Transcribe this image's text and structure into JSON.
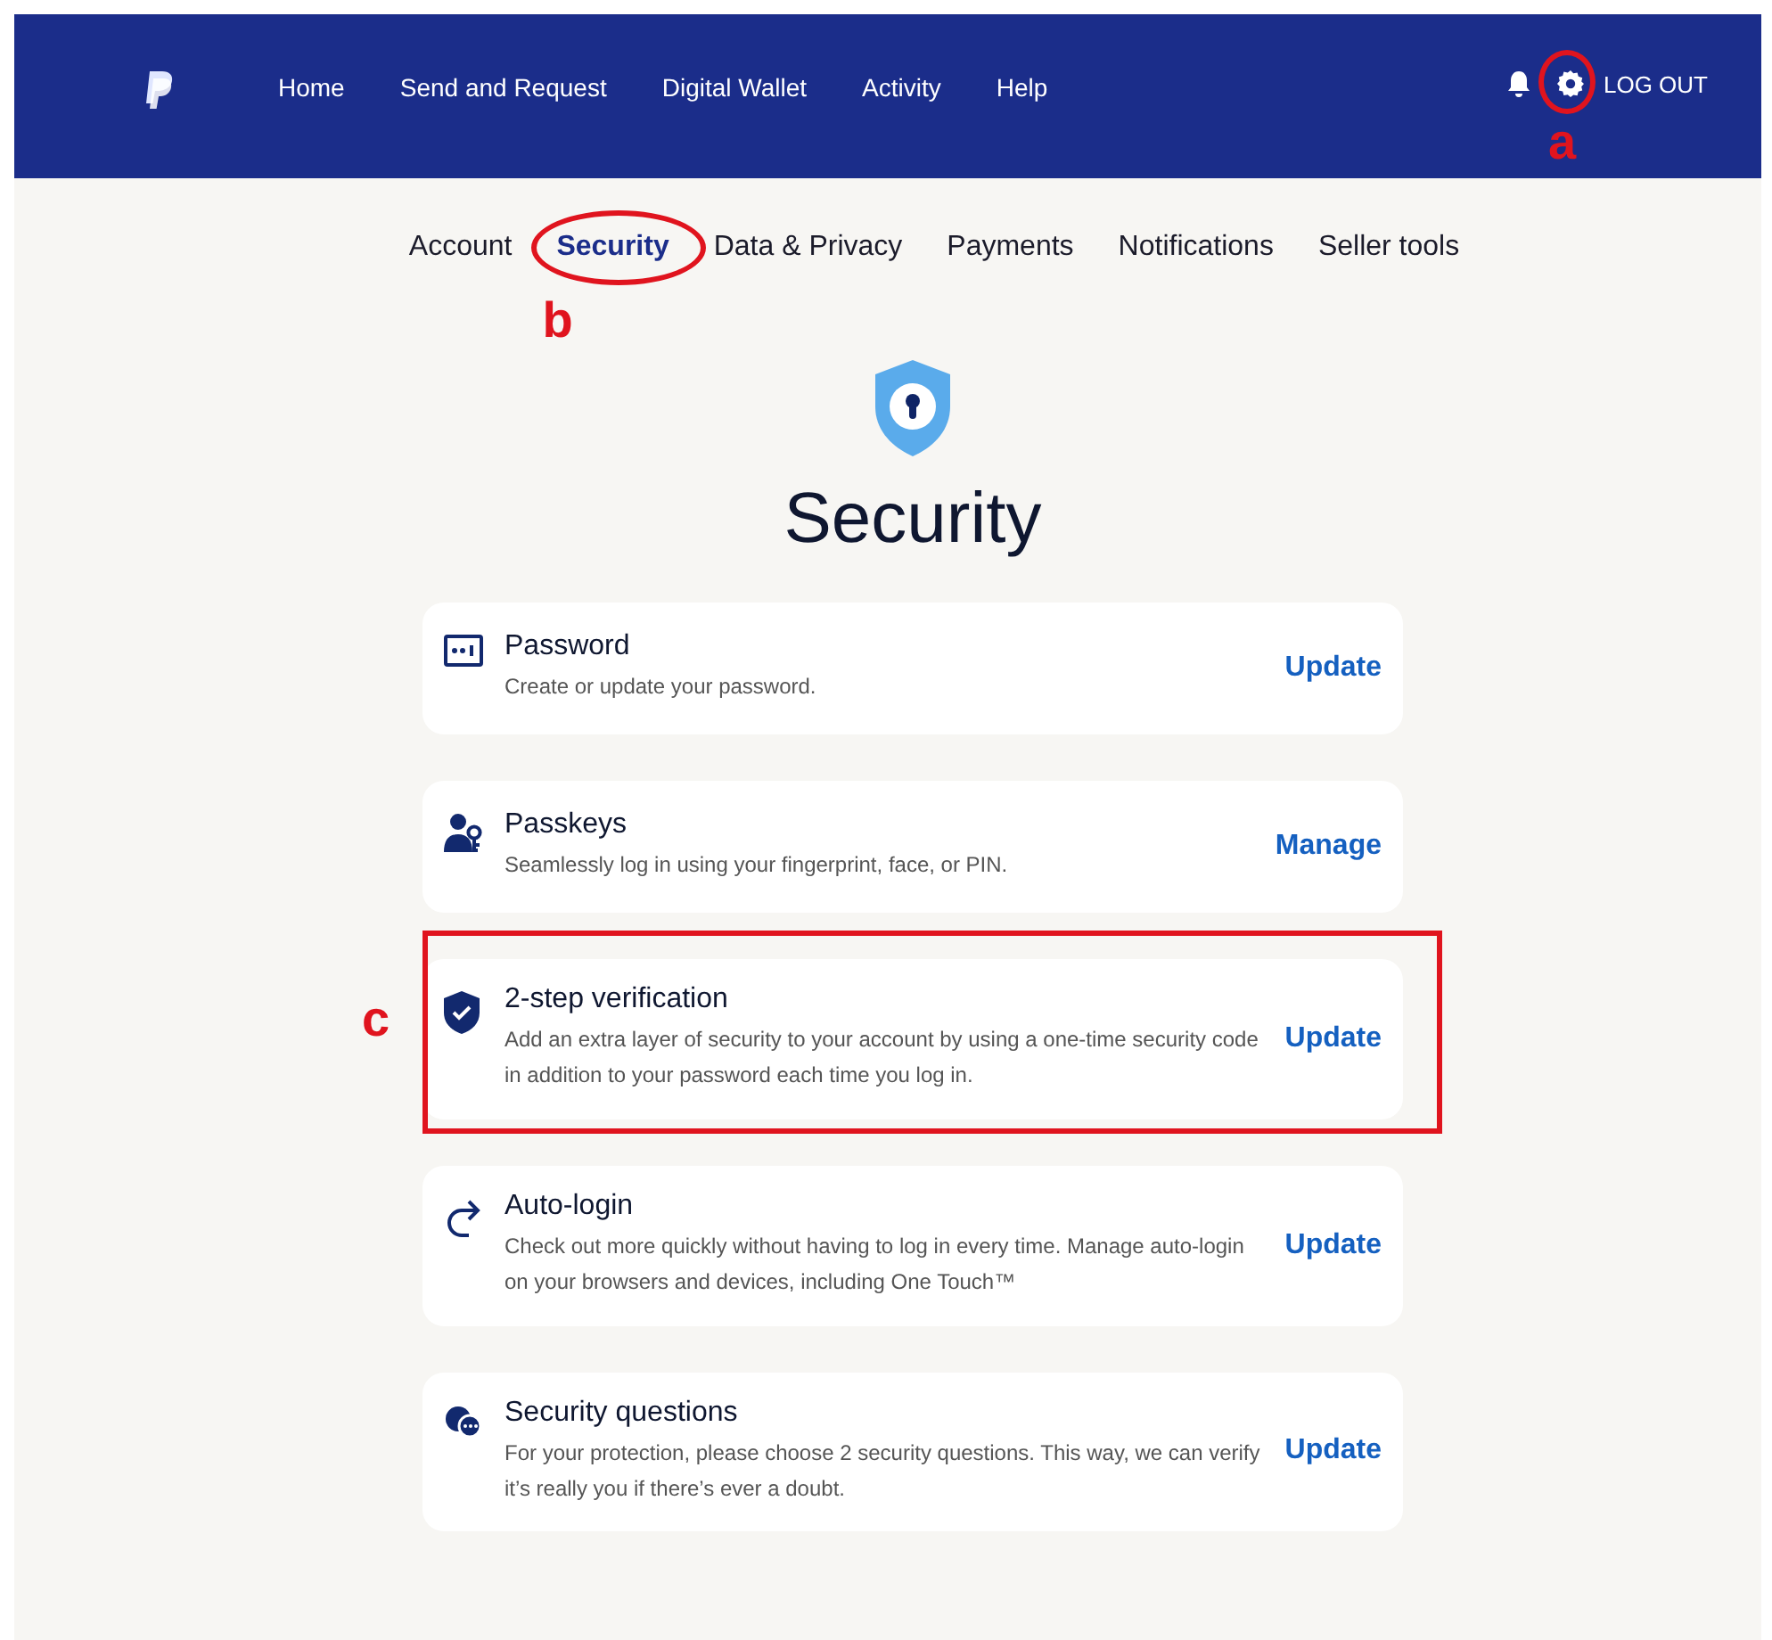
{
  "header": {
    "nav": [
      {
        "label": "Home"
      },
      {
        "label": "Send and Request"
      },
      {
        "label": "Digital Wallet"
      },
      {
        "label": "Activity"
      },
      {
        "label": "Help"
      }
    ],
    "settings_annotation": "a",
    "logout": "LOG OUT"
  },
  "tabs": [
    {
      "label": "Account",
      "selected": false
    },
    {
      "label": "Security",
      "selected": true,
      "annotation": "b"
    },
    {
      "label": "Data & Privacy",
      "selected": false
    },
    {
      "label": "Payments",
      "selected": false
    },
    {
      "label": "Notifications",
      "selected": false
    },
    {
      "label": "Seller tools",
      "selected": false
    }
  ],
  "heading": "Security",
  "items": [
    {
      "kind": "password",
      "title": "Password",
      "description": "Create or update your password.",
      "action": "Update"
    },
    {
      "kind": "passkeys",
      "title": "Passkeys",
      "description": "Seamlessly log in using your fingerprint, face, or PIN.",
      "action": "Manage"
    },
    {
      "kind": "two-step",
      "title": "2-step verification",
      "description": "Add an extra layer of security to your account by using a one-time security code in addition to your password each time you log in.",
      "action": "Update",
      "annotation": "c"
    },
    {
      "kind": "auto-login",
      "title": "Auto-login",
      "description": "Check out more quickly without having to log in every time. Manage auto-login on your browsers and devices, including One Touch™",
      "action": "Update"
    },
    {
      "kind": "questions",
      "title": "Security questions",
      "description": "For your protection, please choose 2 security questions. This way, we can verify it’s really you if there’s ever a doubt.",
      "action": "Update"
    }
  ]
}
